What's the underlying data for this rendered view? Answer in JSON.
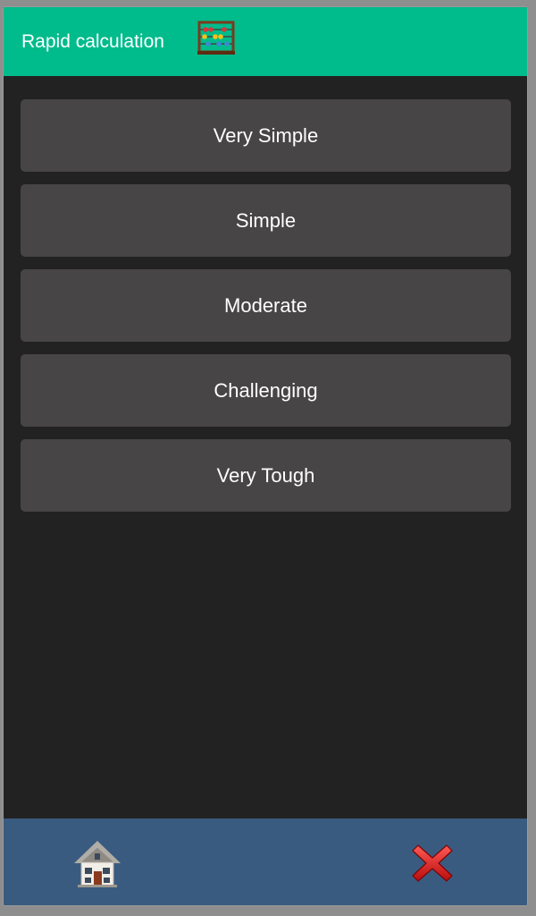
{
  "header": {
    "title": "Rapid calculation",
    "icon": "abacus-icon",
    "background_color": "#00bb8b"
  },
  "menu": {
    "items": [
      {
        "label": "Very Simple"
      },
      {
        "label": "Simple"
      },
      {
        "label": "Moderate"
      },
      {
        "label": "Challenging"
      },
      {
        "label": "Very Tough"
      }
    ],
    "button_color": "#474546"
  },
  "footer": {
    "background_color": "#3a5b80",
    "home_icon": "house-icon",
    "close_icon": "close-x-icon"
  },
  "theme": {
    "background": "#222222",
    "text_color": "#ffffff"
  }
}
